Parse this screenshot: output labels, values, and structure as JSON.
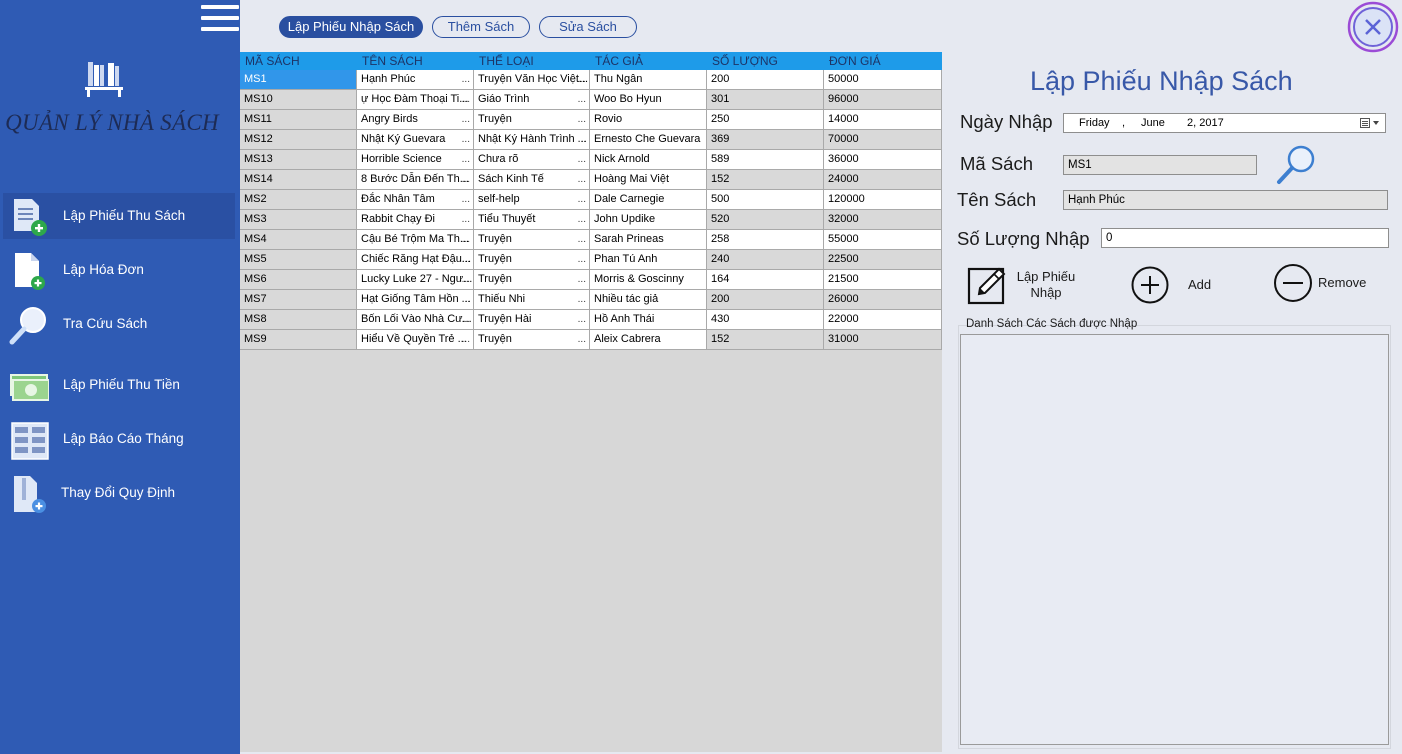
{
  "app": {
    "title": "QUẢN LÝ NHÀ SÁCH"
  },
  "colors": {
    "sidebar": "#2f5bb4",
    "accent": "#2a4fa0",
    "grid_header": "#1e9be9",
    "selected_row": "#3196ea",
    "close_ring": "#9b4bd6"
  },
  "sidebar": {
    "items": [
      {
        "label": "Lập Phiếu Thu Sách",
        "icon": "document-add-icon",
        "active": true
      },
      {
        "label": "Lập Hóa Đơn",
        "icon": "file-add-icon",
        "active": false
      },
      {
        "label": "Tra Cứu Sách",
        "icon": "magnifier-icon",
        "active": false
      },
      {
        "label": "Lập Phiếu Thu Tiền",
        "icon": "money-icon",
        "active": false
      },
      {
        "label": "Lập Báo Cáo Tháng",
        "icon": "report-grid-icon",
        "active": false
      },
      {
        "label": "Thay Đổi Quy Định",
        "icon": "zip-file-add-icon",
        "active": false
      }
    ]
  },
  "tabs": [
    {
      "label": "Lập Phiếu Nhập Sách",
      "active": true
    },
    {
      "label": "Thêm Sách",
      "active": false
    },
    {
      "label": "Sửa Sách",
      "active": false
    }
  ],
  "table": {
    "columns": [
      "MÃ SÁCH",
      "TÊN SÁCH",
      "THỂ LOẠI",
      "TÁC GIẢ",
      "SỐ LƯỢNG",
      "ĐƠN GIÁ"
    ],
    "rows": [
      [
        "MS1",
        "Hạnh Phúc",
        "Truyện Văn Học Việt...",
        "Thu Ngân",
        "200",
        "50000"
      ],
      [
        "MS10",
        "ự Học Đàm Thoại Ti...",
        "Giáo Trình",
        "Woo Bo Hyun",
        "301",
        "96000"
      ],
      [
        "MS11",
        "Angry Birds",
        "Truyện",
        "Rovio",
        "250",
        "14000"
      ],
      [
        "MS12",
        "Nhật Ký Guevara",
        "Nhật Ký Hành Trình ...",
        "Ernesto Che Guevara",
        "369",
        "70000"
      ],
      [
        "MS13",
        "Horrible Science",
        "Chưa rõ",
        " Nick Arnold",
        "589",
        "36000"
      ],
      [
        "MS14",
        "8 Bước Dẫn Đến Th...",
        "Sách Kinh Tế",
        "Hoàng Mai Việt",
        "152",
        "24000"
      ],
      [
        "MS2",
        "Đắc Nhân Tâm",
        "self-help",
        "Dale Carnegie",
        "500",
        "120000"
      ],
      [
        "MS3",
        "Rabbit Chạy Đi",
        "Tiểu Thuyết",
        "John Updike",
        "520",
        "32000"
      ],
      [
        "MS4",
        "Cậu Bé Trộm Ma Th...",
        "Truyện",
        "Sarah Prineas",
        "258",
        "55000"
      ],
      [
        "MS5",
        "Chiếc Răng Hạt Đậu...",
        "Truyện",
        "Phan Tú Anh",
        "240",
        "22500"
      ],
      [
        "MS6",
        "Lucky Luke 27 - Ngư...",
        "Truyện",
        "Morris & Goscinny",
        "164",
        "21500"
      ],
      [
        "MS7",
        "Hạt Giống Tâm Hồn ...",
        " Thiếu Nhi",
        "Nhiều tác giả",
        "200",
        "26000"
      ],
      [
        "MS8",
        "Bốn Lối Vào Nhà Cư...",
        "Truyện Hài",
        "Hồ Anh Thái",
        "430",
        "22000"
      ],
      [
        "MS9",
        "Hiểu Về Quyền Trẻ ...",
        "Truyện",
        "Aleix Cabrera",
        "152",
        "31000"
      ]
    ],
    "selected_row": 0
  },
  "form": {
    "title": "Lập Phiếu Nhập Sách",
    "date_label": "Ngày Nhập",
    "date": {
      "weekday": "Friday",
      "month": "June",
      "day_year": "2, 2017"
    },
    "ma_sach_label": "Mã Sách",
    "ma_sach_value": "MS1",
    "ten_sach_label": "Tên Sách",
    "ten_sach_value": "Hạnh Phúc",
    "so_luong_label": "Số Lượng Nhập",
    "so_luong_value": "0",
    "buttons": {
      "lap_phieu_line1": "Lập Phiếu",
      "lap_phieu_line2": "Nhập",
      "add": "Add",
      "remove": "Remove"
    },
    "list_caption": "Danh Sách Các Sách được Nhập"
  }
}
